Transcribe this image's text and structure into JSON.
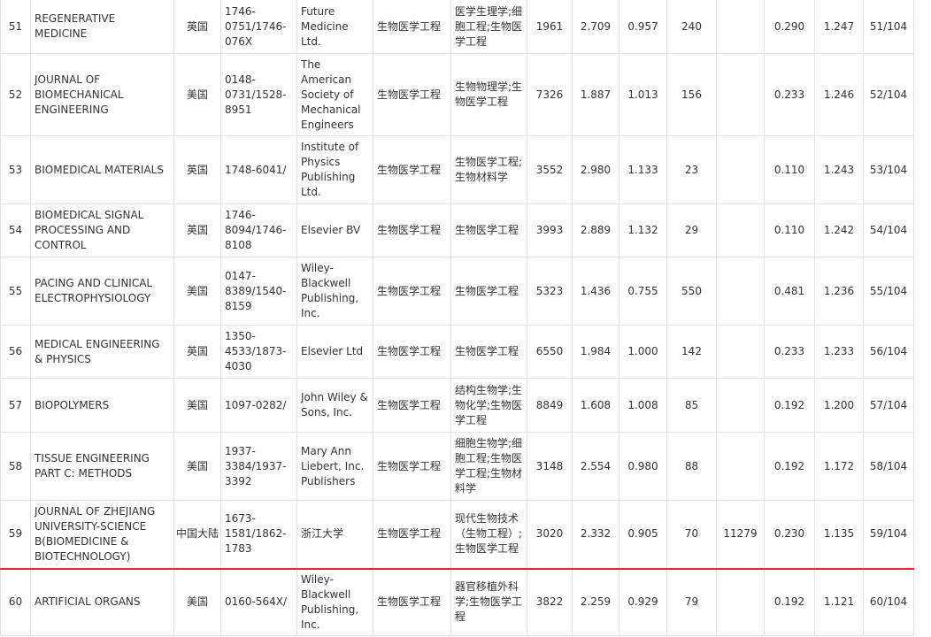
{
  "rows": [
    {
      "rank": "51",
      "journal": "REGENERATIVE MEDICINE",
      "country": "英国",
      "issn": "1746-0751/1746-076X",
      "publisher": "Future Medicine Ltd.",
      "category": "生物医学工程",
      "subjects": "医学生理学;细胞工程;生物医学工程",
      "v1": "1961",
      "v2": "2.709",
      "v3": "0.957",
      "v4": "240",
      "v5": "",
      "v6": "0.290",
      "v7": "1.247",
      "position": "51/104"
    },
    {
      "rank": "52",
      "journal": "JOURNAL OF BIOMECHANICAL ENGINEERING",
      "country": "美国",
      "issn": "0148-0731/1528-8951",
      "publisher": "The American Society of Mechanical Engineers",
      "category": "生物医学工程",
      "subjects": "生物物理学;生物医学工程",
      "v1": "7326",
      "v2": "1.887",
      "v3": "1.013",
      "v4": "156",
      "v5": "",
      "v6": "0.233",
      "v7": "1.246",
      "position": "52/104"
    },
    {
      "rank": "53",
      "journal": "BIOMEDICAL MATERIALS",
      "country": "英国",
      "issn": "1748-6041/",
      "publisher": "Institute of Physics Publishing Ltd.",
      "category": "生物医学工程",
      "subjects": "生物医学工程;生物材料学",
      "v1": "3552",
      "v2": "2.980",
      "v3": "1.133",
      "v4": "23",
      "v5": "",
      "v6": "0.110",
      "v7": "1.243",
      "position": "53/104"
    },
    {
      "rank": "54",
      "journal": "BIOMEDICAL SIGNAL PROCESSING AND CONTROL",
      "country": "英国",
      "issn": "1746-8094/1746-8108",
      "publisher": "Elsevier BV",
      "category": "生物医学工程",
      "subjects": "生物医学工程",
      "v1": "3993",
      "v2": "2.889",
      "v3": "1.132",
      "v4": "29",
      "v5": "",
      "v6": "0.110",
      "v7": "1.242",
      "position": "54/104"
    },
    {
      "rank": "55",
      "journal": "PACING AND CLINICAL ELECTROPHYSIOLOGY",
      "country": "美国",
      "issn": "0147-8389/1540-8159",
      "publisher": "Wiley-Blackwell Publishing, Inc.",
      "category": "生物医学工程",
      "subjects": "生物医学工程",
      "v1": "5323",
      "v2": "1.436",
      "v3": "0.755",
      "v4": "550",
      "v5": "",
      "v6": "0.481",
      "v7": "1.236",
      "position": "55/104"
    },
    {
      "rank": "56",
      "journal": "MEDICAL ENGINEERING & PHYSICS",
      "country": "英国",
      "issn": "1350-4533/1873-4030",
      "publisher": "Elsevier Ltd",
      "category": "生物医学工程",
      "subjects": "生物医学工程",
      "v1": "6550",
      "v2": "1.984",
      "v3": "1.000",
      "v4": "142",
      "v5": "",
      "v6": "0.233",
      "v7": "1.233",
      "position": "56/104"
    },
    {
      "rank": "57",
      "journal": "BIOPOLYMERS",
      "country": "美国",
      "issn": "1097-0282/",
      "publisher": "John Wiley & Sons, Inc.",
      "category": "生物医学工程",
      "subjects": "结构生物学;生物化学;生物医学工程",
      "v1": "8849",
      "v2": "1.608",
      "v3": "1.008",
      "v4": "85",
      "v5": "",
      "v6": "0.192",
      "v7": "1.200",
      "position": "57/104"
    },
    {
      "rank": "58",
      "journal": "TISSUE ENGINEERING PART C: METHODS",
      "country": "美国",
      "issn": "1937-3384/1937-3392",
      "publisher": "Mary Ann Liebert, Inc. Publishers",
      "category": "生物医学工程",
      "subjects": "细胞生物学;细胞工程;生物医学工程;生物材料学",
      "v1": "3148",
      "v2": "2.554",
      "v3": "0.980",
      "v4": "88",
      "v5": "",
      "v6": "0.192",
      "v7": "1.172",
      "position": "58/104"
    },
    {
      "rank": "59",
      "journal": "JOURNAL OF ZHEJIANG UNIVERSITY-SCIENCE B(BIOMEDICINE & BIOTECHNOLOGY)",
      "country": "中国大陆",
      "issn": "1673-1581/1862-1783",
      "publisher": "浙江大学",
      "category": "生物医学工程",
      "subjects": "现代生物技术（生物工程）;生物医学工程",
      "v1": "3020",
      "v2": "2.332",
      "v3": "0.905",
      "v4": "70",
      "v5": "11279",
      "v6": "0.230",
      "v7": "1.135",
      "position": "59/104"
    },
    {
      "rank": "60",
      "journal": "ARTIFICIAL ORGANS",
      "country": "美国",
      "issn": "0160-564X/",
      "publisher": "Wiley-Blackwell Publishing, Inc.",
      "category": "生物医学工程",
      "subjects": "器官移植外科学;生物医学工程",
      "v1": "3822",
      "v2": "2.259",
      "v3": "0.929",
      "v4": "79",
      "v5": "",
      "v6": "0.192",
      "v7": "1.121",
      "position": "60/104"
    }
  ]
}
